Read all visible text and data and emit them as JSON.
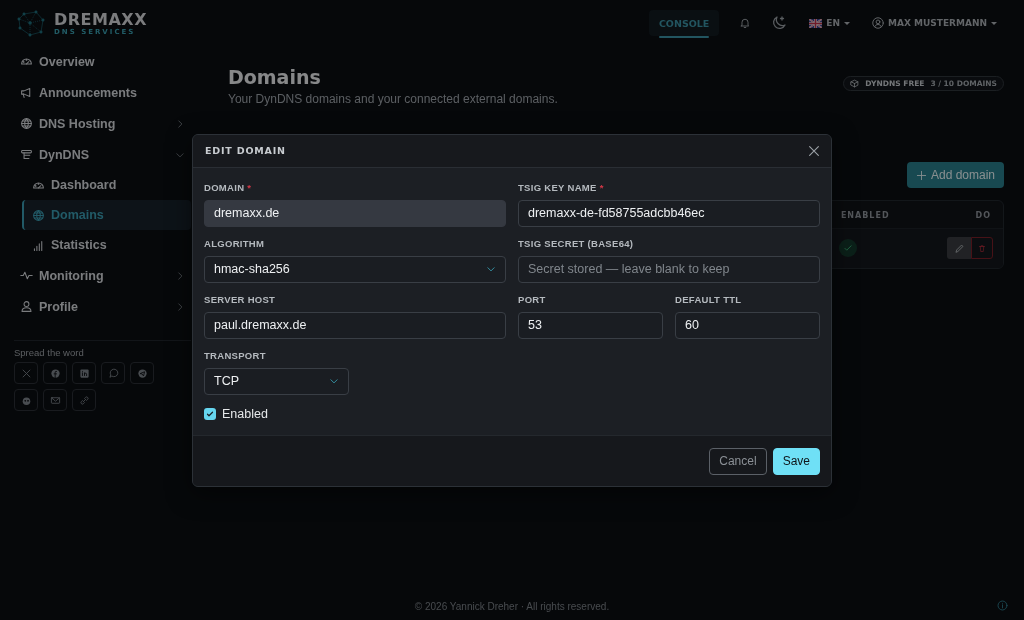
{
  "brand": {
    "name": "DREMAXX",
    "tagline": "DNS SERVICES"
  },
  "header": {
    "nav": [
      {
        "label": "CONSOLE",
        "selected": true
      }
    ],
    "language": "EN",
    "user": "MAX MUSTERMANN"
  },
  "sidebar": {
    "items": [
      {
        "label": "Overview",
        "selected": false
      },
      {
        "label": "Announcements",
        "selected": false
      },
      {
        "label": "DNS Hosting",
        "selected": false,
        "expanded": false
      },
      {
        "label": "DynDNS",
        "selected": false,
        "expanded": true,
        "children": [
          {
            "label": "Dashboard",
            "selected": false
          },
          {
            "label": "Domains",
            "selected": true
          },
          {
            "label": "Statistics",
            "selected": false
          }
        ]
      },
      {
        "label": "Monitoring",
        "selected": false,
        "expanded": false
      },
      {
        "label": "Profile",
        "selected": false,
        "expanded": false
      }
    ],
    "share_title": "Spread the word"
  },
  "page": {
    "title": "Domains",
    "subtitle": "Your DynDNS domains and your connected external domains.",
    "plan": {
      "name": "DYNDNS FREE",
      "usage": "3 / 10 DOMAINS"
    },
    "add_button": "Add domain",
    "table": {
      "columns": [
        "ENABLED",
        "DO"
      ],
      "rows": [
        {
          "enabled": true
        }
      ]
    }
  },
  "dialog": {
    "title": "EDIT DOMAIN",
    "required_mark": "*",
    "fields": [
      {
        "kind": "text",
        "label": "DOMAIN",
        "required": true,
        "value": "dremaxx.de",
        "disabled": true
      },
      {
        "kind": "text",
        "label": "TSIG KEY NAME",
        "required": true,
        "value": "dremaxx-de-fd58755adcbb46ec",
        "disabled": false
      },
      {
        "kind": "select",
        "label": "ALGORITHM",
        "required": false,
        "value": "hmac-sha256",
        "disabled": false
      },
      {
        "kind": "text",
        "label": "TSIG SECRET (BASE64)",
        "required": false,
        "placeholder": "Secret stored — leave blank to keep",
        "disabled": false
      },
      {
        "kind": "text",
        "label": "SERVER HOST",
        "required": false,
        "value": "paul.dremaxx.de",
        "disabled": false
      },
      {
        "kind": "text",
        "label": "PORT",
        "required": false,
        "value": "53",
        "disabled": false
      },
      {
        "kind": "text",
        "label": "DEFAULT TTL",
        "required": false,
        "value": "60",
        "disabled": false
      },
      {
        "kind": "select",
        "label": "TRANSPORT",
        "required": false,
        "value": "TCP",
        "disabled": false
      }
    ],
    "enabled": {
      "label": "Enabled",
      "checked": true
    },
    "buttons": [
      {
        "label": "Cancel",
        "kind": "secondary"
      },
      {
        "label": "Save",
        "kind": "primary"
      }
    ]
  },
  "footer": "© 2026 Yannick Dreher · All rights reserved."
}
